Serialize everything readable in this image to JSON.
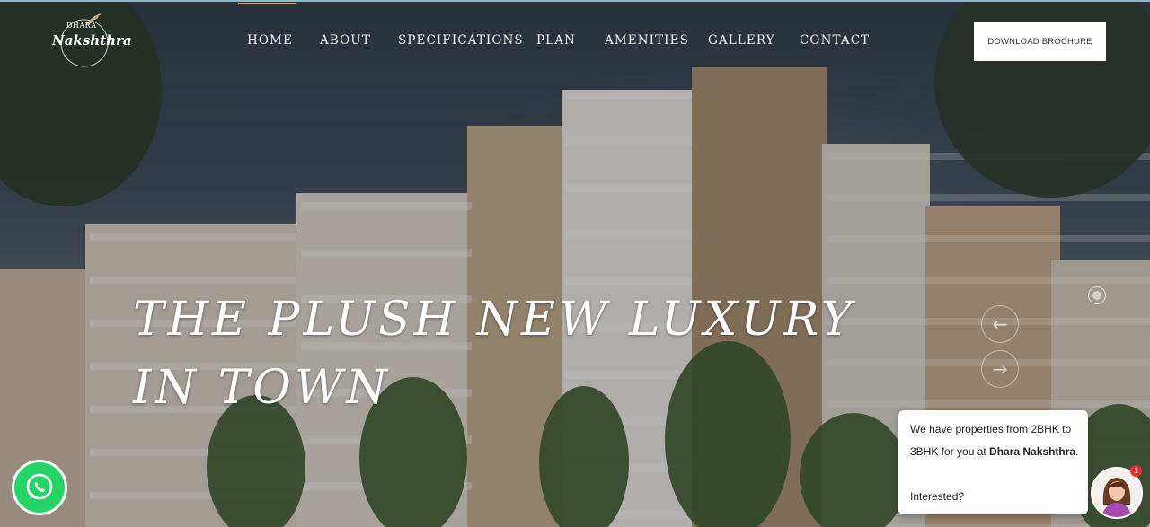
{
  "brand": {
    "small": "DHARA",
    "name": "Nakshthra"
  },
  "nav": {
    "items": [
      "HOME",
      "ABOUT",
      "SPECIFICATIONS",
      "PLAN",
      "AMENITIES",
      "GALLERY",
      "CONTACT"
    ],
    "active": "HOME"
  },
  "cta": {
    "brochure_label": "DOWNLOAD BROCHURE"
  },
  "hero": {
    "line1": "THE PLUSH NEW LUXURY",
    "line2": "IN TOWN"
  },
  "chat": {
    "line1": "We have properties from 2BHK to",
    "line2_prefix": "3BHK for you at ",
    "line2_bold": "Dhara Nakshthra",
    "line2_suffix": ".",
    "line3": "Interested?",
    "badge_count": "1"
  },
  "icons": {
    "whatsapp": "whatsapp-icon",
    "prev": "arrow-left-icon",
    "next": "arrow-right-icon",
    "avatar": "agent-avatar-icon"
  },
  "colors": {
    "whatsapp": "#25d366",
    "badge": "#e8302f",
    "active_line": "#d9a27a"
  }
}
